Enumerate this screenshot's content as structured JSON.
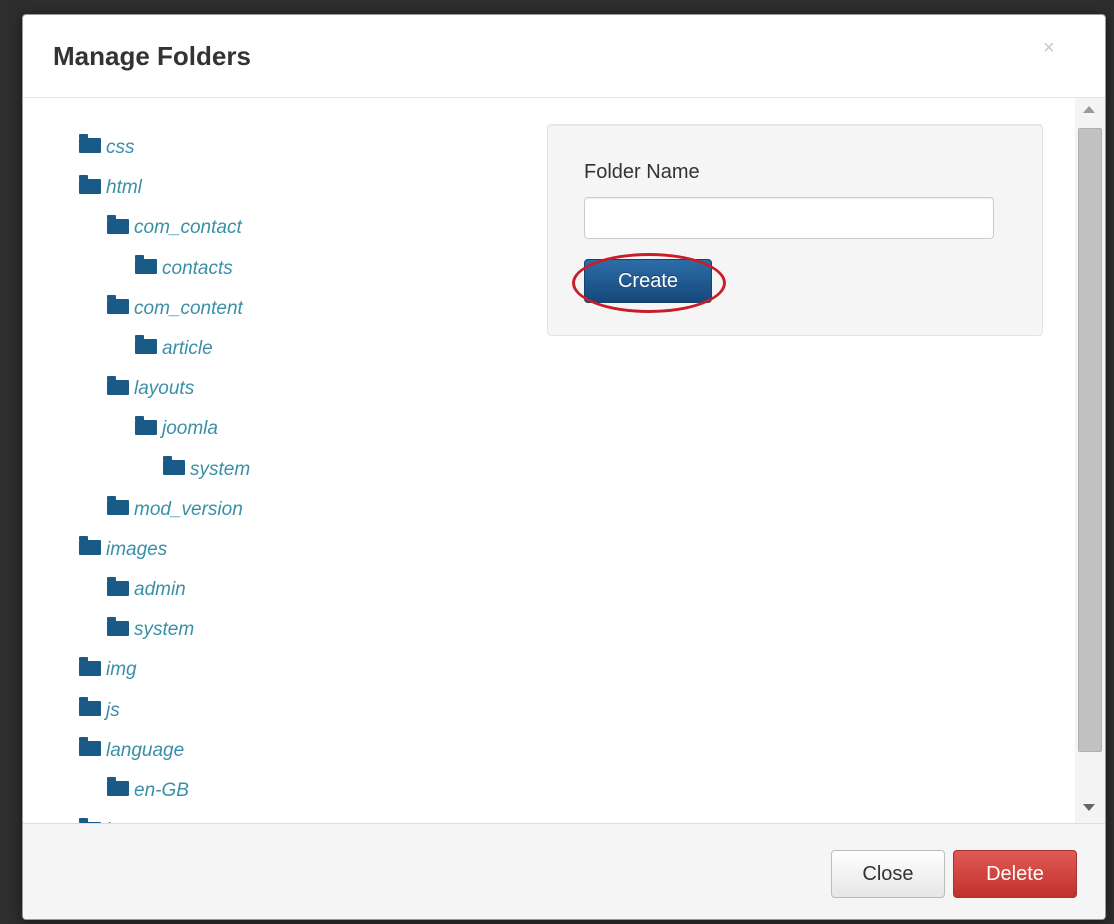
{
  "dialog": {
    "title": "Manage Folders",
    "close_glyph": "×"
  },
  "tree": {
    "items": [
      {
        "label": "css",
        "depth": 0
      },
      {
        "label": "html",
        "depth": 0
      },
      {
        "label": "com_contact",
        "depth": 1
      },
      {
        "label": "contacts",
        "depth": 2
      },
      {
        "label": "com_content",
        "depth": 1
      },
      {
        "label": "article",
        "depth": 2
      },
      {
        "label": "layouts",
        "depth": 1
      },
      {
        "label": "joomla",
        "depth": 2
      },
      {
        "label": "system",
        "depth": 3
      },
      {
        "label": "mod_version",
        "depth": 1
      },
      {
        "label": "images",
        "depth": 0
      },
      {
        "label": "admin",
        "depth": 1
      },
      {
        "label": "system",
        "depth": 1
      },
      {
        "label": "img",
        "depth": 0
      },
      {
        "label": "js",
        "depth": 0
      },
      {
        "label": "language",
        "depth": 0
      },
      {
        "label": "en-GB",
        "depth": 1
      },
      {
        "label": "less",
        "depth": 0
      }
    ]
  },
  "form": {
    "folder_label": "Folder Name",
    "folder_value": "",
    "create_label": "Create"
  },
  "footer": {
    "close_label": "Close",
    "delete_label": "Delete"
  },
  "colors": {
    "folder_icon": "#1a5a86",
    "tree_text": "#3a8fa8",
    "primary_button": "#15487a",
    "danger_button": "#c2302b",
    "highlight_ring": "#c81e28"
  },
  "icons": {
    "tree_item": "folder-icon",
    "close": "close-icon"
  }
}
